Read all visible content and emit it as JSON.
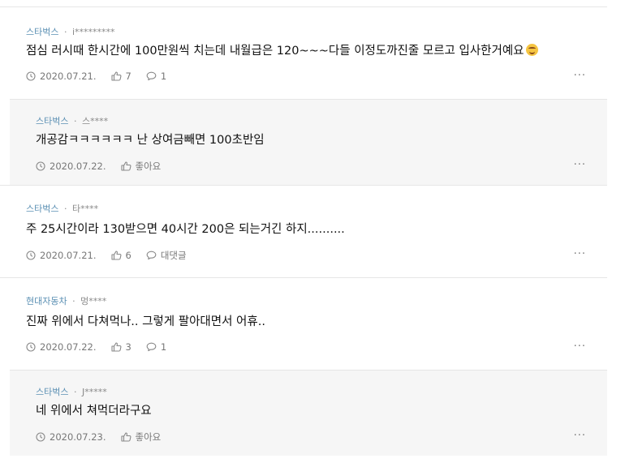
{
  "comments": [
    {
      "company": "스타벅스",
      "separator": "·",
      "user": "i*********",
      "text": "점심 러시때 한시간에 100만원씩 치는데 내월급은 120~~~다들 이정도까진줄 모르고 입사한거예요",
      "emoji": "grinning-sweat-face",
      "date": "2020.07.21.",
      "likes": "7",
      "replies": "1",
      "more": "···"
    },
    {
      "company": "스타벅스",
      "separator": "·",
      "user": "스****",
      "text": "개공감ㅋㅋㅋㅋㅋㅋ 난 상여금빼면 100초반임",
      "date": "2020.07.22.",
      "likes": "좋아요",
      "more": "···"
    },
    {
      "company": "스타벅스",
      "separator": "·",
      "user": "타****",
      "text": "주 25시간이라 130받으면 40시간 200은 되는거긴 하지..........",
      "date": "2020.07.21.",
      "likes": "6",
      "replies": "대댓글",
      "more": "···"
    },
    {
      "company": "현대자동차",
      "separator": "·",
      "user": "멍****",
      "text": "진짜 위에서 다쳐먹나.. 그렇게 팔아대면서 어휴..",
      "date": "2020.07.22.",
      "likes": "3",
      "replies": "1",
      "more": "···"
    },
    {
      "company": "스타벅스",
      "separator": "·",
      "user": "J*****",
      "text": "네 위에서 쳐먹더라구요",
      "date": "2020.07.23.",
      "likes": "좋아요",
      "more": "···"
    }
  ],
  "colors": {
    "company": "#5a8fb3",
    "reply_bg": "#f6f6f6",
    "divider": "#e6e6e6"
  }
}
